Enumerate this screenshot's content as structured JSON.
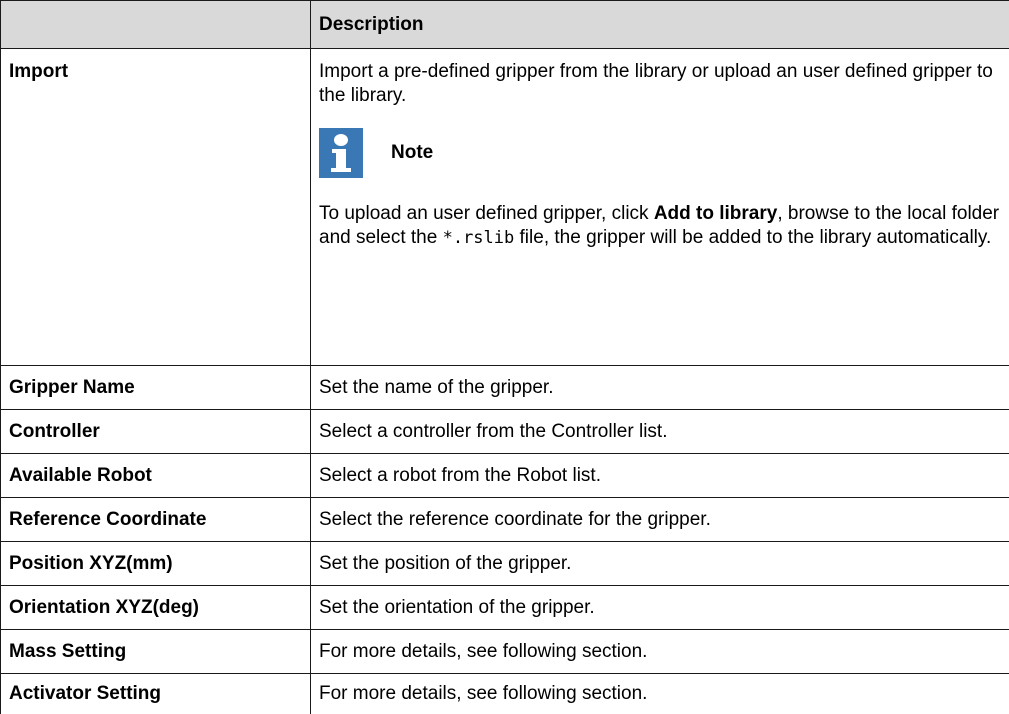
{
  "table": {
    "header": {
      "col1": "",
      "col2": "Description"
    },
    "import_row": {
      "term": "Import",
      "description": "Import a pre-defined gripper from the library or upload an user defined gripper to the library.",
      "note": {
        "icon": "info-icon",
        "label": "Note",
        "text_part1": "To upload an user defined gripper, click ",
        "bold_action": "Add to library",
        "text_part2": ", browse to the local folder and select the ",
        "code": "*.rslib",
        "text_part3": " file, the gripper will be added to the library automatically."
      }
    },
    "rows": [
      {
        "term": "Gripper Name",
        "description": "Set the name of the gripper."
      },
      {
        "term": "Controller",
        "description": "Select a controller from the Controller list."
      },
      {
        "term": "Available Robot",
        "description": "Select a robot from the Robot list."
      },
      {
        "term": "Reference Coordinate",
        "description": "Select the reference coordinate for the gripper."
      },
      {
        "term": "Position XYZ(mm)",
        "description": "Set the position of the gripper."
      },
      {
        "term": "Orientation XYZ(deg)",
        "description": "Set the orientation of the gripper."
      },
      {
        "term": "Mass Setting",
        "description": "For more details, see following section."
      },
      {
        "term": "Activator Setting",
        "description": "For more details, see following section."
      }
    ]
  },
  "colors": {
    "header_background": "#d9d9d9",
    "info_icon": "#3a78b5",
    "border": "#1a1a1a"
  }
}
